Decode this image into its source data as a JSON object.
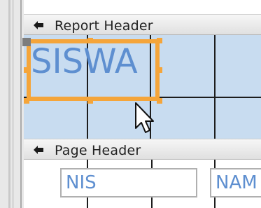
{
  "sections": [
    {
      "label": "Report Header"
    },
    {
      "label": "Page Header"
    }
  ],
  "report_header": {
    "selected_label_text": "SISWA"
  },
  "page_header": {
    "fields": [
      {
        "label": "NIS"
      },
      {
        "label": "NAM"
      }
    ]
  },
  "colors": {
    "selection": "#f5a53a",
    "section_fill": "#c8dcf0",
    "label_text": "#5e8fd0"
  },
  "icons": {
    "section_toggle": "section-collapse-arrow-icon",
    "pointer": "mouse-pointer-icon"
  }
}
